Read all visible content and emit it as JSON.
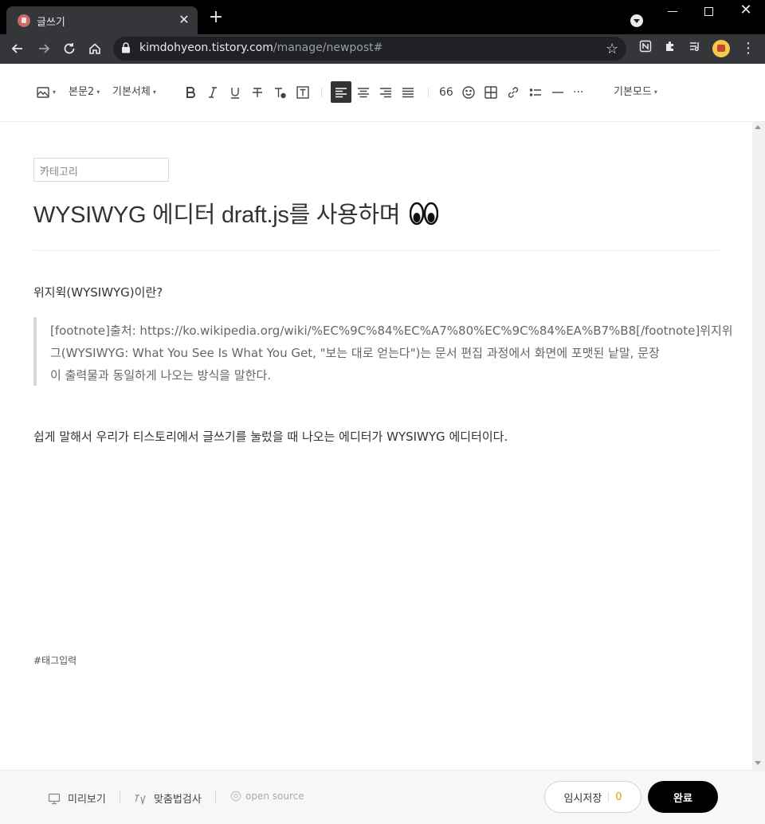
{
  "browser": {
    "tab_title": "글쓰기",
    "url_host": "kimdohyeon.tistory.com",
    "url_path": "/manage/newpost#",
    "new_tab_glyph": "+",
    "close_glyph": "✕"
  },
  "editor_toolbar": {
    "image_icon": "image-icon",
    "paragraph_style": "본문2",
    "font_family": "기본서체",
    "mode": "기본모드",
    "quote_glyph": "66",
    "more_glyph": "···"
  },
  "post": {
    "category_placeholder": "카테고리",
    "title": "WYSIWYG 에디터 draft.js를 사용하며",
    "paragraph1": "위지윅(WYSIWYG)이란?",
    "quote_line1": "[footnote]출처: https://ko.wikipedia.org/wiki/%EC%9C%84%EC%A7%80%EC%9C%84%EA%B7%B8[/footnote]위지위",
    "quote_line2": "그(WYSIWYG: What You See Is What You Get, \"보는 대로 얻는다\")는 문서 편집 과정에서 화면에 포맷된 낱말, 문장",
    "quote_line3": "이 출력물과 동일하게 나오는 방식을 말한다.",
    "paragraph2": "쉽게 말해서 우리가 티스토리에서 글쓰기를 눌렀을 때 나오는 에디터가 WYSIWYG 에디터이다.",
    "tag_placeholder": "#태그입력"
  },
  "footer": {
    "preview": "미리보기",
    "spellcheck": "맞춤법검사",
    "open_source": "open source",
    "draft_label": "임시저장",
    "draft_count": "0",
    "done_label": "완료"
  },
  "colors": {
    "chrome_dark": "#35363a",
    "omnibox": "#202124",
    "draft_count": "#d9a400",
    "done_button": "#000000"
  }
}
